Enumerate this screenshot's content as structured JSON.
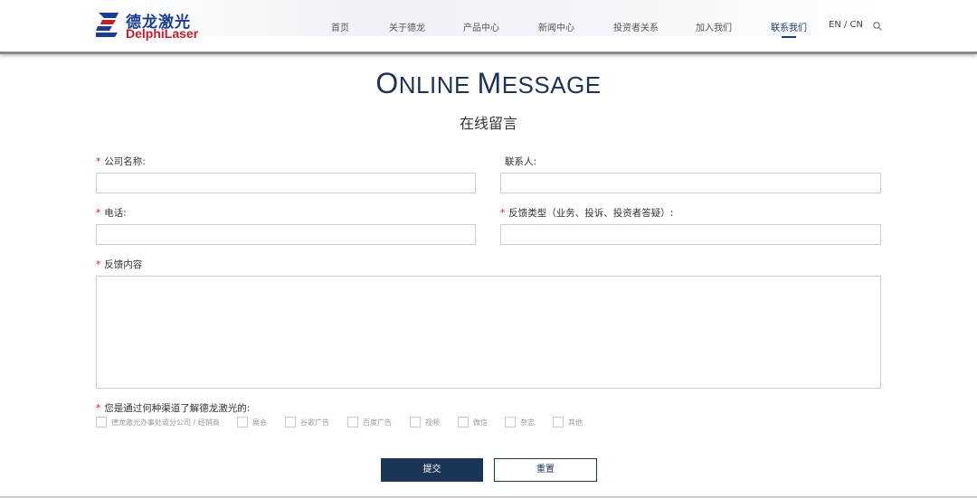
{
  "header": {
    "logo": {
      "name_cn": "德龙激光",
      "name_en": "DelphiLaser"
    },
    "nav": [
      {
        "label": "首页"
      },
      {
        "label": "关于德龙"
      },
      {
        "label": "产品中心"
      },
      {
        "label": "新闻中心"
      },
      {
        "label": "投资者关系"
      },
      {
        "label": "加入我们"
      },
      {
        "label": "联系我们",
        "active": true
      }
    ],
    "lang": "EN / CN",
    "icons": {
      "search": "search-icon"
    }
  },
  "page": {
    "title_en_first": "O",
    "title_en_rest1": "NLINE ",
    "title_en_second": "M",
    "title_en_rest2": "ESSAGE",
    "title_cn": "在线留言"
  },
  "form": {
    "required_mark": "*",
    "company": {
      "label": "公司名称:",
      "value": ""
    },
    "contact": {
      "label": "联系人:",
      "value": ""
    },
    "phone": {
      "label": "电话:",
      "value": ""
    },
    "feedback_type": {
      "label": "反馈类型（业务、投诉、投资者答疑）:",
      "value": ""
    },
    "content": {
      "label": "反馈内容",
      "value": ""
    },
    "channel": {
      "label": "您是通过何种渠道了解德龙激光的:",
      "options": [
        {
          "label": "德龙激光办事处或分公司 / 经销商",
          "checked": false
        },
        {
          "label": "展会",
          "checked": false
        },
        {
          "label": "谷歌广告",
          "checked": false
        },
        {
          "label": "百度广告",
          "checked": false
        },
        {
          "label": "视频",
          "checked": false
        },
        {
          "label": "微信",
          "checked": false
        },
        {
          "label": "杂志",
          "checked": false
        },
        {
          "label": "其他",
          "checked": false
        }
      ]
    },
    "submit_label": "提交",
    "reset_label": "重置"
  },
  "colors": {
    "brand_blue": "#1a3d8f",
    "brand_red": "#c41e2a",
    "navy": "#1b3557",
    "required": "#c8202e"
  }
}
